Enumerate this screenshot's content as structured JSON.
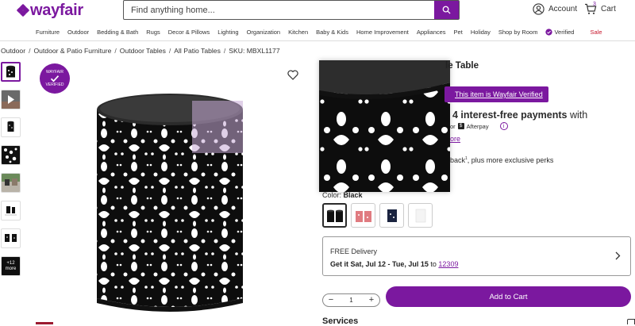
{
  "header": {
    "logo_text": "wayfair",
    "search_placeholder": "Find anything home...",
    "account_label": "Account",
    "cart_label": "Cart",
    "cart_count": "3",
    "brand_color": "#7b189f"
  },
  "nav": {
    "items": [
      "Furniture",
      "Outdoor",
      "Bedding & Bath",
      "Rugs",
      "Decor & Pillows",
      "Lighting",
      "Organization",
      "Kitchen",
      "Baby & Kids",
      "Home Improvement",
      "Appliances",
      "Pet",
      "Holiday",
      "Shop by Room"
    ],
    "verified_label": "Verified",
    "sale_label": "Sale"
  },
  "breadcrumb": {
    "items": [
      "Outdoor",
      "Outdoor & Patio Furniture",
      "Outdoor Tables",
      "All Patio Tables"
    ],
    "sku": "SKU: MBXL1177"
  },
  "gallery": {
    "more_label": "+12",
    "more_sub": "more",
    "badge_top": "WAYFAIR",
    "badge_bottom": "VERIFIED"
  },
  "product": {
    "title_fragment": "le Table",
    "verified_link": "This item is Wayfair Verified",
    "payments_bold": "4 interest-free payments",
    "payments_with": "with",
    "afterpay_prefix": "or",
    "afterpay_label": "Afterpay",
    "learn_more_fragment": "ore",
    "perks_fragment": "back",
    "perks_sup": "1",
    "perks_rest": ", plus more exclusive perks",
    "color_label": "Color:",
    "color_value": "Black"
  },
  "delivery": {
    "title": "FREE Delivery",
    "get_it": "Get it Sat, Jul 12 - Tue, Jul 15",
    "to": "to",
    "zip": "12309"
  },
  "purchase": {
    "qty": "1",
    "minus": "−",
    "plus": "+",
    "add_to_cart": "Add to Cart"
  },
  "sections": {
    "services": "Services"
  }
}
